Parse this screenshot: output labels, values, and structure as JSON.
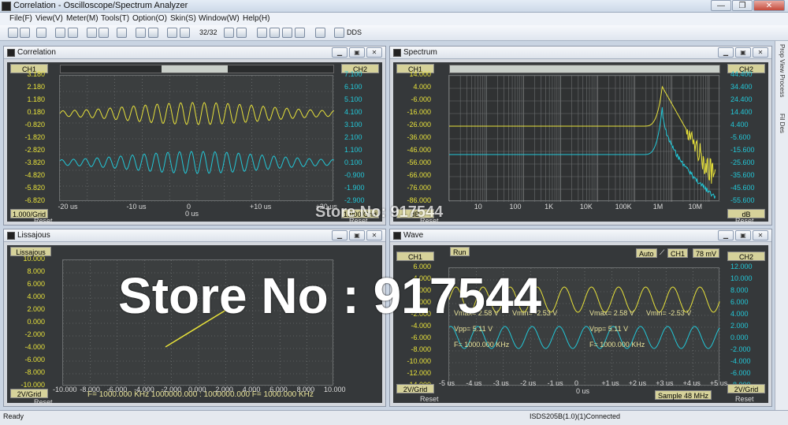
{
  "window": {
    "title": "Correlation - Oscilloscope/Spectrum Analyzer",
    "buttons": [
      "—",
      "❐",
      "✕"
    ]
  },
  "menu": [
    "File(F)",
    "View(V)",
    "Meter(M)",
    "Tools(T)",
    "Option(O)",
    "Skin(S)",
    "Window(W)",
    "Help(H)"
  ],
  "toolbar": {
    "page_counter": "32/32",
    "dds_label": "DDS"
  },
  "correlation": {
    "title": "Correlation",
    "ch1_label": "CH1",
    "ch2_label": "CH2",
    "ch1_ticks": [
      "3.180",
      "2.180",
      "1.180",
      "0.180",
      "-0.820",
      "-1.820",
      "-2.820",
      "-3.820",
      "-4.820",
      "-5.820",
      "-6.820"
    ],
    "ch2_ticks": [
      "7.100",
      "6.100",
      "5.100",
      "4.100",
      "3.100",
      "2.100",
      "1.100",
      "0.100",
      "-0.900",
      "-1.900",
      "-2.900"
    ],
    "x_ticks": [
      "-20 us",
      "-10 us",
      "0",
      "+10 us",
      "+20 us"
    ],
    "center_label": "0 us",
    "scale_left": "1.000/Grid",
    "scale_right": "1.000/Grid",
    "reset_left": "Reset",
    "reset_right": "Reset"
  },
  "spectrum": {
    "title": "Spectrum",
    "ch1_label": "CH1",
    "ch2_label": "CH2",
    "ch1_ticks": [
      "14.000",
      "4.000",
      "-6.000",
      "-16.000",
      "-26.000",
      "-36.000",
      "-46.000",
      "-56.000",
      "-66.000",
      "-76.000",
      "-86.000"
    ],
    "ch2_ticks": [
      "44.400",
      "34.400",
      "24.400",
      "14.400",
      "4.400",
      "-5.600",
      "-15.600",
      "-25.600",
      "-35.600",
      "-45.600",
      "-55.600"
    ],
    "x_ticks": [
      "10",
      "100",
      "1K",
      "10K",
      "100K",
      "1M",
      "10M"
    ],
    "scale_left": "dB",
    "scale_right": "dB",
    "reset_left": "Reset",
    "reset_right": "Reset"
  },
  "lissajous": {
    "title": "Lissajous",
    "label": "Lissajous",
    "y_ticks": [
      "10.000",
      "8.000",
      "6.000",
      "4.000",
      "2.000",
      "0.000",
      "-2.000",
      "-4.000",
      "-6.000",
      "-8.000",
      "-10.000"
    ],
    "x_ticks": [
      "-10.000",
      "-8.000",
      "-6.000",
      "-4.000",
      "-2.000",
      "0.000",
      "2.000",
      "4.000",
      "6.000",
      "8.000",
      "10.000"
    ],
    "footer": "F= 1000.000 KHz   1000000.000 : 1000000.000   F= 1000.000 KHz",
    "scale": "2V/Grid",
    "reset": "Reset"
  },
  "wave": {
    "title": "Wave",
    "ch1_label": "CH1",
    "ch2_label": "CH2",
    "run_label": "Run",
    "auto_label": "Auto",
    "trig_ch": "CH1",
    "trig_level": "78 mV",
    "ch1_ticks": [
      "6.000",
      "4.000",
      "2.000",
      "0.000",
      "-2.000",
      "-4.000",
      "-6.000",
      "-8.000",
      "-10.000",
      "-12.000",
      "-14.000"
    ],
    "ch2_ticks": [
      "12.000",
      "10.000",
      "8.000",
      "6.000",
      "4.000",
      "2.000",
      "0.000",
      "-2.000",
      "-4.000",
      "-6.000",
      "-8.000"
    ],
    "x_ticks": [
      "-5 us",
      "-4 us",
      "-3 us",
      "-2 us",
      "-1 us",
      "0",
      "+1 us",
      "+2 us",
      "+3 us",
      "+4 us",
      "+5 us"
    ],
    "center_label": "0 us",
    "sample": "Sample 48 MHz",
    "measure_left": {
      "vmax": "Vmax= 2.58 V",
      "vmin": "Vmin= -2.53 V",
      "vpp": "Vpp= 5.11 V",
      "freq": "F= 1000.000 KHz"
    },
    "measure_right": {
      "vmax": "Vmax= 2.58 V",
      "vmin": "Vmin= -2.53 V",
      "vpp": "Vpp= 5.11 V",
      "freq": "F= 1000.000 KHz"
    },
    "scale_left": "2V/Grid",
    "scale_right": "2V/Grid",
    "reset_left": "Reset",
    "reset_right": "Reset"
  },
  "sidebar": {
    "tab1": "Prop View Process",
    "tab2": "Fil Des"
  },
  "status": {
    "left": "Ready",
    "right": "ISDS205B(1.0)(1)Connected"
  },
  "watermark": {
    "small": "Store No: 917544",
    "large": "Store No : 917544"
  },
  "colors": {
    "ch1": "#e8e23a",
    "ch2": "#22c8d8",
    "bg": "#35383a"
  }
}
